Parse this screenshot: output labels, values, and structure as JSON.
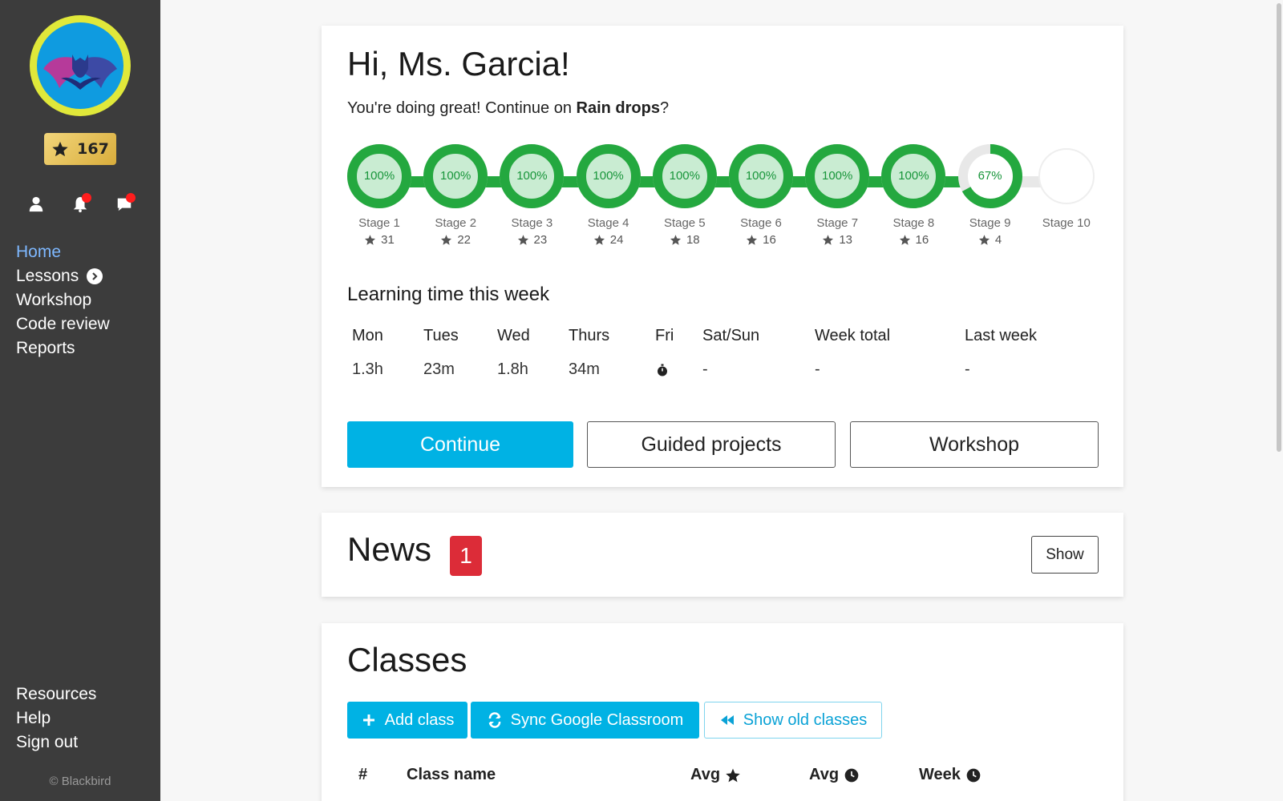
{
  "sidebar": {
    "stars": "167",
    "nav": [
      "Home",
      "Lessons",
      "Workshop",
      "Code review",
      "Reports"
    ],
    "bottom_nav": [
      "Resources",
      "Help",
      "Sign out"
    ],
    "copyright": "© Blackbird",
    "colors": {
      "background": "#3c3c3c",
      "active": "#7eb8ff",
      "notification": "#ff1d1d"
    }
  },
  "welcome": {
    "greeting": "Hi, Ms. Garcia!",
    "subtitle_prefix": "You're doing great! Continue on ",
    "lesson": "Rain drops",
    "subtitle_suffix": "?",
    "stages": [
      {
        "name": "Stage 1",
        "progress": "100%",
        "stars": "31",
        "fraction": 1
      },
      {
        "name": "Stage 2",
        "progress": "100%",
        "stars": "22",
        "fraction": 1
      },
      {
        "name": "Stage 3",
        "progress": "100%",
        "stars": "23",
        "fraction": 1
      },
      {
        "name": "Stage 4",
        "progress": "100%",
        "stars": "24",
        "fraction": 1
      },
      {
        "name": "Stage 5",
        "progress": "100%",
        "stars": "18",
        "fraction": 1
      },
      {
        "name": "Stage 6",
        "progress": "100%",
        "stars": "16",
        "fraction": 1
      },
      {
        "name": "Stage 7",
        "progress": "100%",
        "stars": "13",
        "fraction": 1
      },
      {
        "name": "Stage 8",
        "progress": "100%",
        "stars": "16",
        "fraction": 1
      },
      {
        "name": "Stage 9",
        "progress": "67%",
        "stars": "4",
        "fraction": 0.67
      },
      {
        "name": "Stage 10",
        "progress": "",
        "stars": "",
        "fraction": 0
      }
    ],
    "learning_title": "Learning time this week",
    "week": {
      "headers": [
        "Mon",
        "Tues",
        "Wed",
        "Thurs",
        "Fri",
        "Sat/Sun",
        "Week total",
        "Last week"
      ],
      "values": [
        "1.3h",
        "23m",
        "1.8h",
        "34m",
        "",
        "-",
        "-",
        "-"
      ]
    },
    "buttons": {
      "continue": "Continue",
      "guided": "Guided projects",
      "workshop": "Workshop"
    },
    "colors": {
      "progress": "#24a83f",
      "progress_fill": "#c9ecd2",
      "primary": "#00b2e4"
    }
  },
  "news": {
    "title": "News",
    "count": "1",
    "show": "Show",
    "badge_color": "#dc2c38"
  },
  "classes": {
    "title": "Classes",
    "add": "Add class",
    "sync": "Sync Google Classroom",
    "old": "Show old classes",
    "headers": [
      "#",
      "Class name",
      "Avg",
      "Avg",
      "Week"
    ]
  }
}
